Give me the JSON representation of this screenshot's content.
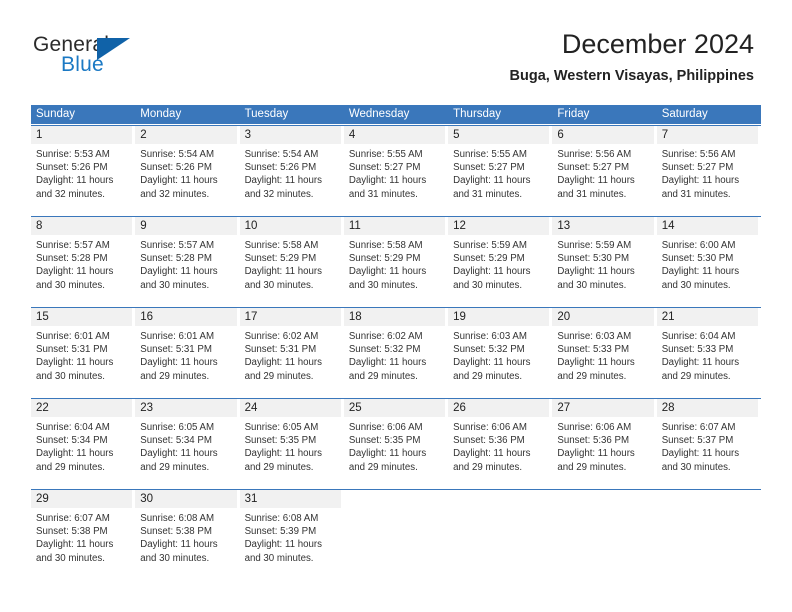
{
  "logo": {
    "word_one": "General",
    "word_two": "Blue",
    "colors": {
      "general": "#2b2b2b",
      "blue": "#1b79c4",
      "triangle": "#1062a8"
    }
  },
  "header": {
    "title": "December 2024",
    "subtitle": "Buga, Western Visayas, Philippines"
  },
  "theme": {
    "header_blue": "#3a77bb",
    "daynum_band": "#f1f1f1",
    "row_divider": "#3a77bb",
    "text": "#333333"
  },
  "weekdays": [
    "Sunday",
    "Monday",
    "Tuesday",
    "Wednesday",
    "Thursday",
    "Friday",
    "Saturday"
  ],
  "weeks": [
    [
      {
        "day": "1",
        "sunrise": "Sunrise: 5:53 AM",
        "sunset": "Sunset: 5:26 PM",
        "daylight1": "Daylight: 11 hours",
        "daylight2": "and 32 minutes."
      },
      {
        "day": "2",
        "sunrise": "Sunrise: 5:54 AM",
        "sunset": "Sunset: 5:26 PM",
        "daylight1": "Daylight: 11 hours",
        "daylight2": "and 32 minutes."
      },
      {
        "day": "3",
        "sunrise": "Sunrise: 5:54 AM",
        "sunset": "Sunset: 5:26 PM",
        "daylight1": "Daylight: 11 hours",
        "daylight2": "and 32 minutes."
      },
      {
        "day": "4",
        "sunrise": "Sunrise: 5:55 AM",
        "sunset": "Sunset: 5:27 PM",
        "daylight1": "Daylight: 11 hours",
        "daylight2": "and 31 minutes."
      },
      {
        "day": "5",
        "sunrise": "Sunrise: 5:55 AM",
        "sunset": "Sunset: 5:27 PM",
        "daylight1": "Daylight: 11 hours",
        "daylight2": "and 31 minutes."
      },
      {
        "day": "6",
        "sunrise": "Sunrise: 5:56 AM",
        "sunset": "Sunset: 5:27 PM",
        "daylight1": "Daylight: 11 hours",
        "daylight2": "and 31 minutes."
      },
      {
        "day": "7",
        "sunrise": "Sunrise: 5:56 AM",
        "sunset": "Sunset: 5:27 PM",
        "daylight1": "Daylight: 11 hours",
        "daylight2": "and 31 minutes."
      }
    ],
    [
      {
        "day": "8",
        "sunrise": "Sunrise: 5:57 AM",
        "sunset": "Sunset: 5:28 PM",
        "daylight1": "Daylight: 11 hours",
        "daylight2": "and 30 minutes."
      },
      {
        "day": "9",
        "sunrise": "Sunrise: 5:57 AM",
        "sunset": "Sunset: 5:28 PM",
        "daylight1": "Daylight: 11 hours",
        "daylight2": "and 30 minutes."
      },
      {
        "day": "10",
        "sunrise": "Sunrise: 5:58 AM",
        "sunset": "Sunset: 5:29 PM",
        "daylight1": "Daylight: 11 hours",
        "daylight2": "and 30 minutes."
      },
      {
        "day": "11",
        "sunrise": "Sunrise: 5:58 AM",
        "sunset": "Sunset: 5:29 PM",
        "daylight1": "Daylight: 11 hours",
        "daylight2": "and 30 minutes."
      },
      {
        "day": "12",
        "sunrise": "Sunrise: 5:59 AM",
        "sunset": "Sunset: 5:29 PM",
        "daylight1": "Daylight: 11 hours",
        "daylight2": "and 30 minutes."
      },
      {
        "day": "13",
        "sunrise": "Sunrise: 5:59 AM",
        "sunset": "Sunset: 5:30 PM",
        "daylight1": "Daylight: 11 hours",
        "daylight2": "and 30 minutes."
      },
      {
        "day": "14",
        "sunrise": "Sunrise: 6:00 AM",
        "sunset": "Sunset: 5:30 PM",
        "daylight1": "Daylight: 11 hours",
        "daylight2": "and 30 minutes."
      }
    ],
    [
      {
        "day": "15",
        "sunrise": "Sunrise: 6:01 AM",
        "sunset": "Sunset: 5:31 PM",
        "daylight1": "Daylight: 11 hours",
        "daylight2": "and 30 minutes."
      },
      {
        "day": "16",
        "sunrise": "Sunrise: 6:01 AM",
        "sunset": "Sunset: 5:31 PM",
        "daylight1": "Daylight: 11 hours",
        "daylight2": "and 29 minutes."
      },
      {
        "day": "17",
        "sunrise": "Sunrise: 6:02 AM",
        "sunset": "Sunset: 5:31 PM",
        "daylight1": "Daylight: 11 hours",
        "daylight2": "and 29 minutes."
      },
      {
        "day": "18",
        "sunrise": "Sunrise: 6:02 AM",
        "sunset": "Sunset: 5:32 PM",
        "daylight1": "Daylight: 11 hours",
        "daylight2": "and 29 minutes."
      },
      {
        "day": "19",
        "sunrise": "Sunrise: 6:03 AM",
        "sunset": "Sunset: 5:32 PM",
        "daylight1": "Daylight: 11 hours",
        "daylight2": "and 29 minutes."
      },
      {
        "day": "20",
        "sunrise": "Sunrise: 6:03 AM",
        "sunset": "Sunset: 5:33 PM",
        "daylight1": "Daylight: 11 hours",
        "daylight2": "and 29 minutes."
      },
      {
        "day": "21",
        "sunrise": "Sunrise: 6:04 AM",
        "sunset": "Sunset: 5:33 PM",
        "daylight1": "Daylight: 11 hours",
        "daylight2": "and 29 minutes."
      }
    ],
    [
      {
        "day": "22",
        "sunrise": "Sunrise: 6:04 AM",
        "sunset": "Sunset: 5:34 PM",
        "daylight1": "Daylight: 11 hours",
        "daylight2": "and 29 minutes."
      },
      {
        "day": "23",
        "sunrise": "Sunrise: 6:05 AM",
        "sunset": "Sunset: 5:34 PM",
        "daylight1": "Daylight: 11 hours",
        "daylight2": "and 29 minutes."
      },
      {
        "day": "24",
        "sunrise": "Sunrise: 6:05 AM",
        "sunset": "Sunset: 5:35 PM",
        "daylight1": "Daylight: 11 hours",
        "daylight2": "and 29 minutes."
      },
      {
        "day": "25",
        "sunrise": "Sunrise: 6:06 AM",
        "sunset": "Sunset: 5:35 PM",
        "daylight1": "Daylight: 11 hours",
        "daylight2": "and 29 minutes."
      },
      {
        "day": "26",
        "sunrise": "Sunrise: 6:06 AM",
        "sunset": "Sunset: 5:36 PM",
        "daylight1": "Daylight: 11 hours",
        "daylight2": "and 29 minutes."
      },
      {
        "day": "27",
        "sunrise": "Sunrise: 6:06 AM",
        "sunset": "Sunset: 5:36 PM",
        "daylight1": "Daylight: 11 hours",
        "daylight2": "and 29 minutes."
      },
      {
        "day": "28",
        "sunrise": "Sunrise: 6:07 AM",
        "sunset": "Sunset: 5:37 PM",
        "daylight1": "Daylight: 11 hours",
        "daylight2": "and 30 minutes."
      }
    ],
    [
      {
        "day": "29",
        "sunrise": "Sunrise: 6:07 AM",
        "sunset": "Sunset: 5:38 PM",
        "daylight1": "Daylight: 11 hours",
        "daylight2": "and 30 minutes."
      },
      {
        "day": "30",
        "sunrise": "Sunrise: 6:08 AM",
        "sunset": "Sunset: 5:38 PM",
        "daylight1": "Daylight: 11 hours",
        "daylight2": "and 30 minutes."
      },
      {
        "day": "31",
        "sunrise": "Sunrise: 6:08 AM",
        "sunset": "Sunset: 5:39 PM",
        "daylight1": "Daylight: 11 hours",
        "daylight2": "and 30 minutes."
      },
      {
        "day": "",
        "sunrise": "",
        "sunset": "",
        "daylight1": "",
        "daylight2": ""
      },
      {
        "day": "",
        "sunrise": "",
        "sunset": "",
        "daylight1": "",
        "daylight2": ""
      },
      {
        "day": "",
        "sunrise": "",
        "sunset": "",
        "daylight1": "",
        "daylight2": ""
      },
      {
        "day": "",
        "sunrise": "",
        "sunset": "",
        "daylight1": "",
        "daylight2": ""
      }
    ]
  ]
}
